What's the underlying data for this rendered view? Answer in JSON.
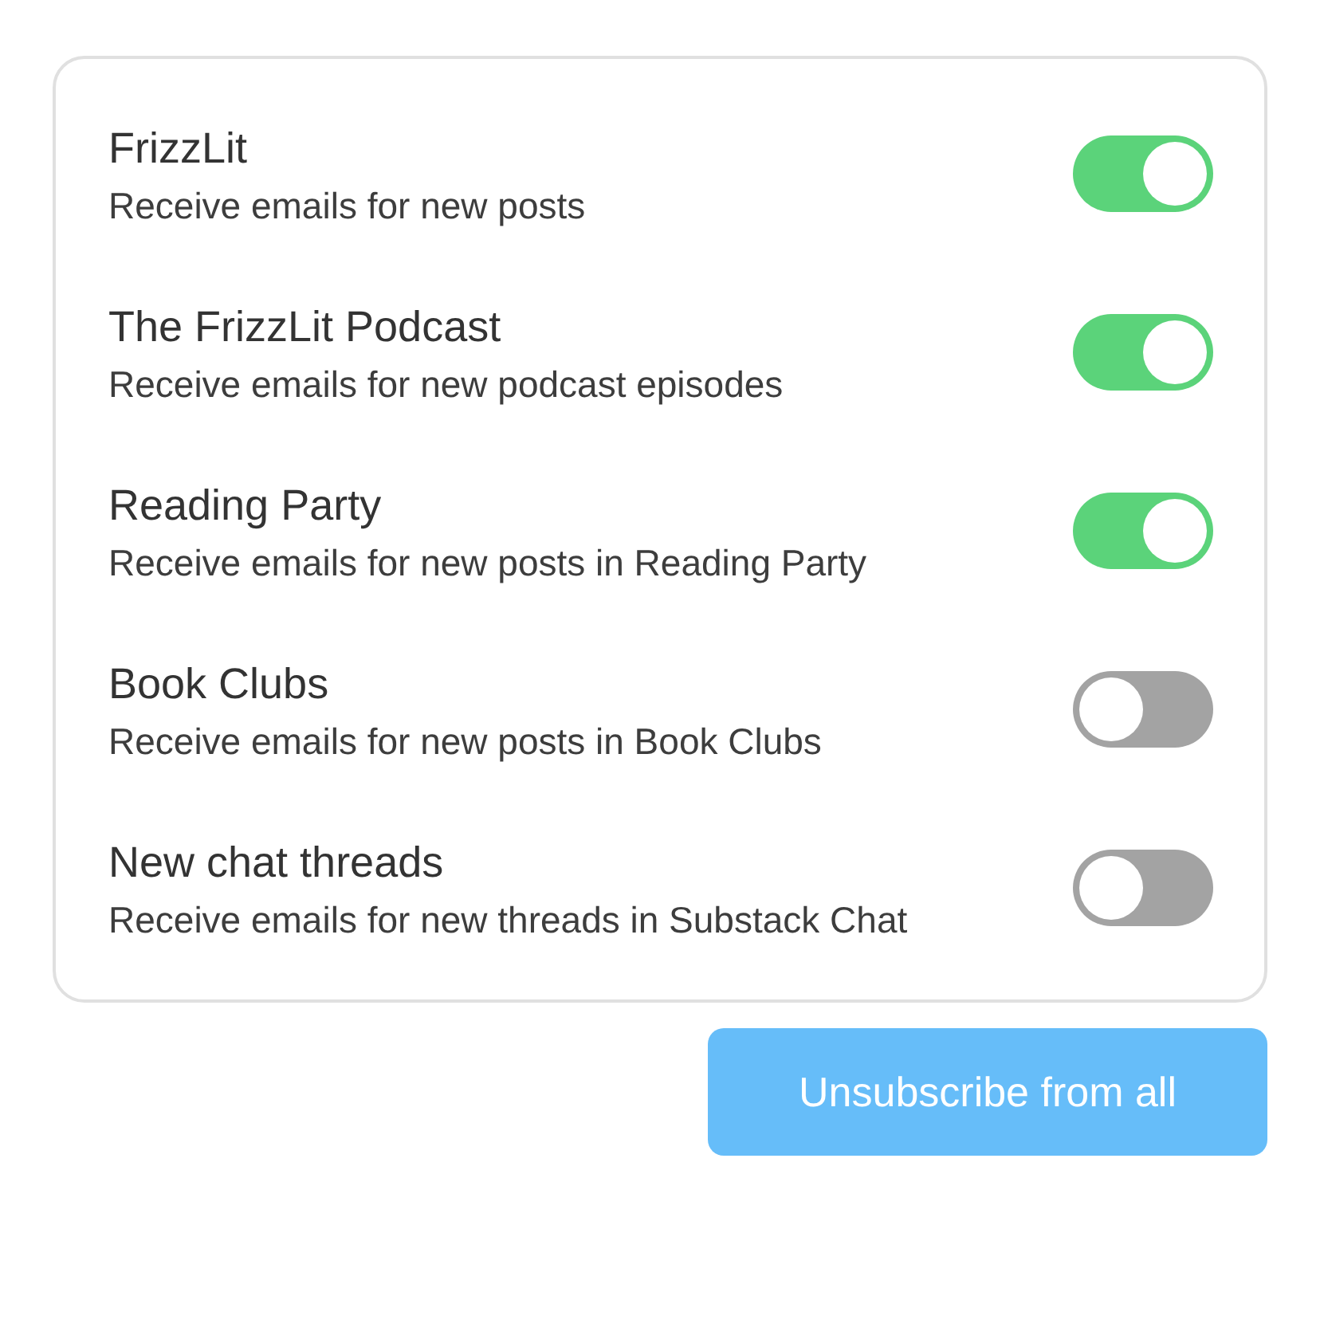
{
  "subscriptions": [
    {
      "title": "FrizzLit",
      "description": "Receive emails for new posts",
      "on": true
    },
    {
      "title": "The FrizzLit Podcast",
      "description": "Receive emails for new podcast episodes",
      "on": true
    },
    {
      "title": "Reading Party",
      "description": "Receive emails for new posts in Reading Party",
      "on": true
    },
    {
      "title": "Book Clubs",
      "description": "Receive emails for new posts in Book Clubs",
      "on": false
    },
    {
      "title": "New chat threads",
      "description": "Receive emails for new threads in Substack Chat",
      "on": false
    }
  ],
  "button": "Unsubscribe from all"
}
